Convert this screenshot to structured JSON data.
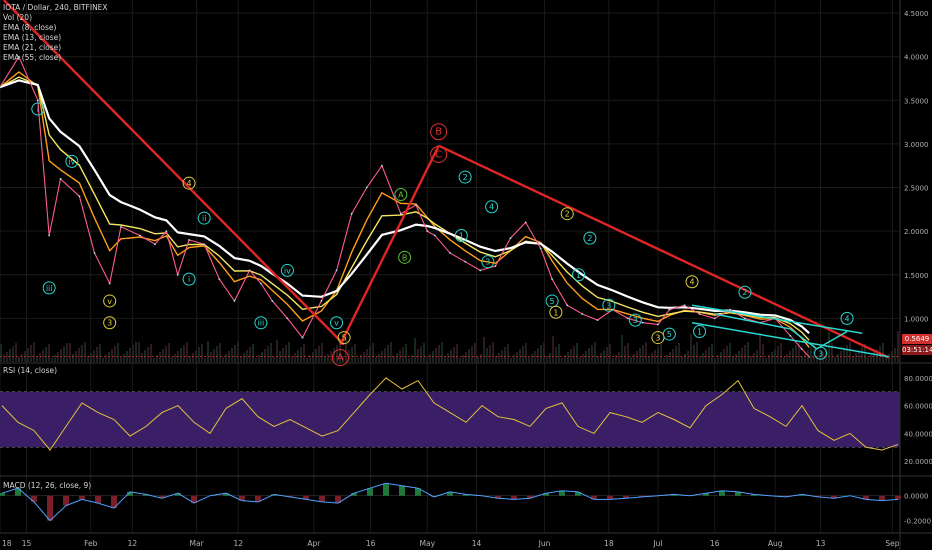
{
  "header": {
    "symbol_line": "IOTA / Dollar, 240, BITFINEX",
    "indicators": [
      "Vol (20)",
      "EMA (8, close)",
      "EMA (13, close)",
      "EMA (21, close)",
      "EMA (55, close)"
    ]
  },
  "price_tags": {
    "last_price": "0.5649",
    "countdown": "03:51:14"
  },
  "rsi_label": "RSI (14, close)",
  "macd_label": "MACD (12, 26, close, 9)",
  "chart_data": [
    {
      "type": "line",
      "title": "IOTA / Dollar, 240, BITFINEX",
      "x_tick_labels": [
        "18",
        "15",
        "Feb",
        "12",
        "Mar",
        "12",
        "Apr",
        "16",
        "May",
        "14",
        "Jun",
        "18",
        "Jul",
        "16",
        "Aug",
        "13",
        "Sep"
      ],
      "y_tick_labels": [
        "4.5000",
        "4.0000",
        "3.5000",
        "3.0000",
        "2.5000",
        "2.0000",
        "1.5000",
        "1.0000"
      ],
      "ylim": [
        0.5,
        4.65
      ],
      "grid": true,
      "series": [
        {
          "name": "IOTA / Dollar",
          "color": "#ff5b8d",
          "x": [
            "2018-01-08",
            "2018-01-13",
            "2018-01-18",
            "2018-01-21",
            "2018-01-24",
            "2018-01-29",
            "2018-02-02",
            "2018-02-06",
            "2018-02-09",
            "2018-02-14",
            "2018-02-18",
            "2018-02-21",
            "2018-02-24",
            "2018-02-27",
            "2018-03-03",
            "2018-03-07",
            "2018-03-11",
            "2018-03-15",
            "2018-03-18",
            "2018-03-21",
            "2018-03-25",
            "2018-03-29",
            "2018-04-03",
            "2018-04-07",
            "2018-04-11",
            "2018-04-15",
            "2018-04-19",
            "2018-04-24",
            "2018-04-28",
            "2018-05-01",
            "2018-05-03",
            "2018-05-07",
            "2018-05-11",
            "2018-05-15",
            "2018-05-19",
            "2018-05-23",
            "2018-05-27",
            "2018-05-31",
            "2018-06-03",
            "2018-06-07",
            "2018-06-11",
            "2018-06-15",
            "2018-06-19",
            "2018-06-23",
            "2018-06-27",
            "2018-07-01",
            "2018-07-04",
            "2018-07-08",
            "2018-07-12",
            "2018-07-16",
            "2018-07-20",
            "2018-07-24",
            "2018-07-28",
            "2018-08-01",
            "2018-08-05",
            "2018-08-08",
            "2018-08-10"
          ],
          "y": [
            3.65,
            4.0,
            3.5,
            1.95,
            2.6,
            2.4,
            1.75,
            1.4,
            2.05,
            1.95,
            1.85,
            2.0,
            1.5,
            1.9,
            1.85,
            1.45,
            1.2,
            1.55,
            1.4,
            1.2,
            1.0,
            0.78,
            1.2,
            1.55,
            2.2,
            2.5,
            2.75,
            2.2,
            2.3,
            2.0,
            1.95,
            1.75,
            1.65,
            1.55,
            1.6,
            1.92,
            2.1,
            1.8,
            1.45,
            1.15,
            1.05,
            0.98,
            1.1,
            1.0,
            0.95,
            0.93,
            1.1,
            1.15,
            1.05,
            1.0,
            1.1,
            1.0,
            0.95,
            1.0,
            0.8,
            0.65,
            0.56
          ]
        }
      ]
    },
    {
      "type": "line",
      "title": "RSI (14, close)",
      "y_tick_labels": [
        "80.0000",
        "60.0000",
        "40.0000",
        "20.0000"
      ],
      "ylim": [
        10,
        90
      ],
      "band": [
        30,
        70
      ],
      "series": [
        {
          "name": "RSI (14, close)",
          "color": "#e1c43b",
          "y": [
            60,
            48,
            42,
            28,
            45,
            62,
            55,
            50,
            38,
            45,
            55,
            60,
            48,
            40,
            58,
            65,
            52,
            45,
            50,
            44,
            38,
            42,
            55,
            68,
            80,
            72,
            78,
            62,
            55,
            48,
            60,
            52,
            50,
            45,
            58,
            62,
            45,
            40,
            55,
            52,
            48,
            55,
            50,
            44,
            60,
            68,
            78,
            58,
            52,
            45,
            60,
            42,
            35,
            40,
            30,
            28,
            32
          ]
        }
      ]
    },
    {
      "type": "line",
      "title": "MACD (12, 26, close, 9)",
      "y_tick_labels": [
        "0.0000",
        "-0.2000"
      ],
      "ylim": [
        -0.3,
        0.15
      ],
      "series": [
        {
          "name": "MACD (12, 26, close, 9)",
          "color": "#4ea1ff",
          "y": [
            0.02,
            0.06,
            -0.05,
            -0.2,
            -0.08,
            -0.03,
            -0.06,
            -0.1,
            0.03,
            0.01,
            -0.02,
            0.02,
            -0.06,
            0.0,
            0.02,
            -0.04,
            -0.05,
            0.01,
            -0.01,
            -0.03,
            -0.05,
            -0.06,
            0.02,
            0.06,
            0.1,
            0.08,
            0.06,
            -0.01,
            0.03,
            0.01,
            0.0,
            -0.02,
            -0.03,
            -0.02,
            0.02,
            0.04,
            0.03,
            -0.03,
            -0.03,
            -0.02,
            -0.01,
            0.0,
            0.01,
            0.0,
            0.02,
            0.04,
            0.03,
            0.01,
            0.0,
            -0.01,
            0.01,
            -0.01,
            -0.02,
            0.0,
            -0.03,
            -0.04,
            -0.03
          ]
        }
      ]
    }
  ],
  "wave_labels": [
    {
      "text": "i",
      "color": "#2bd6cf",
      "x": "2018-01-18",
      "y": 3.4
    },
    {
      "text": "iii",
      "color": "#2bd6cf",
      "x": "2018-01-21",
      "y": 1.35
    },
    {
      "text": "iv",
      "color": "#2bd6cf",
      "x": "2018-01-27",
      "y": 2.8
    },
    {
      "text": "v",
      "color": "#e0d040",
      "x": "2018-02-06",
      "y": 1.2
    },
    {
      "text": "3",
      "color": "#e0d040",
      "x": "2018-02-06",
      "y": 0.95
    },
    {
      "text": "4",
      "color": "#e0d040",
      "x": "2018-02-27",
      "y": 2.55
    },
    {
      "text": "ii",
      "color": "#2bd6cf",
      "x": "2018-03-03",
      "y": 2.15
    },
    {
      "text": "i",
      "color": "#2bd6cf",
      "x": "2018-02-27",
      "y": 1.45
    },
    {
      "text": "iii",
      "color": "#2bd6cf",
      "x": "2018-03-18",
      "y": 0.95
    },
    {
      "text": "iv",
      "color": "#2bd6cf",
      "x": "2018-03-25",
      "y": 1.55
    },
    {
      "text": "v",
      "color": "#2bd6cf",
      "x": "2018-04-07",
      "y": 0.95
    },
    {
      "text": "5",
      "color": "#e0d040",
      "x": "2018-04-09",
      "y": 0.78
    },
    {
      "text": "A",
      "color": "#e03030",
      "x": "2018-04-08",
      "y": 0.55
    },
    {
      "text": "A",
      "color": "#5bc236",
      "x": "2018-04-24",
      "y": 2.42
    },
    {
      "text": "B",
      "color": "#5bc236",
      "x": "2018-04-25",
      "y": 1.7
    },
    {
      "text": "C",
      "color": "#e03030",
      "x": "2018-05-04",
      "y": 2.88
    },
    {
      "text": "B",
      "color": "#e03030",
      "x": "2018-05-04",
      "y": 3.14
    },
    {
      "text": "2",
      "color": "#2bd6cf",
      "x": "2018-05-11",
      "y": 2.62
    },
    {
      "text": "1",
      "color": "#2bd6cf",
      "x": "2018-05-10",
      "y": 1.95
    },
    {
      "text": "4",
      "color": "#2bd6cf",
      "x": "2018-05-18",
      "y": 2.28
    },
    {
      "text": "3",
      "color": "#2bd6cf",
      "x": "2018-05-17",
      "y": 1.65
    },
    {
      "text": "2",
      "color": "#e0d040",
      "x": "2018-06-07",
      "y": 2.2
    },
    {
      "text": "2",
      "color": "#2bd6cf",
      "x": "2018-06-13",
      "y": 1.92
    },
    {
      "text": "1",
      "color": "#2bd6cf",
      "x": "2018-06-10",
      "y": 1.5
    },
    {
      "text": "5",
      "color": "#2bd6cf",
      "x": "2018-06-03",
      "y": 1.2
    },
    {
      "text": "1",
      "color": "#e0d040",
      "x": "2018-06-04",
      "y": 1.07
    },
    {
      "text": "3",
      "color": "#2bd6cf",
      "x": "2018-06-18",
      "y": 1.15
    },
    {
      "text": "3",
      "color": "#2bd6cf",
      "x": "2018-06-25",
      "y": 0.98
    },
    {
      "text": "3",
      "color": "#e0d040",
      "x": "2018-07-01",
      "y": 0.78
    },
    {
      "text": "5",
      "color": "#2bd6cf",
      "x": "2018-07-04",
      "y": 0.82
    },
    {
      "text": "4",
      "color": "#e0d040",
      "x": "2018-07-10",
      "y": 1.42
    },
    {
      "text": "1",
      "color": "#2bd6cf",
      "x": "2018-07-12",
      "y": 0.85
    },
    {
      "text": "2",
      "color": "#2bd6cf",
      "x": "2018-07-24",
      "y": 1.3
    },
    {
      "text": "3",
      "color": "#2bd6cf",
      "x": "2018-08-13",
      "y": 0.6
    },
    {
      "text": "4",
      "color": "#2bd6cf",
      "x": "2018-08-20",
      "y": 1.0
    }
  ],
  "trend_lines": [
    {
      "color": "#e02525",
      "points": [
        [
          "2018-01-09",
          4.65
        ],
        [
          "2018-04-09",
          0.7
        ]
      ]
    },
    {
      "color": "#e02525",
      "points": [
        [
          "2018-04-08",
          0.7
        ],
        [
          "2018-05-04",
          2.98
        ]
      ]
    },
    {
      "color": "#e02525",
      "points": [
        [
          "2018-05-04",
          2.98
        ],
        [
          "2018-08-31",
          0.55
        ]
      ]
    },
    {
      "color": "#2bd6cf",
      "points": [
        [
          "2018-07-10",
          1.15
        ],
        [
          "2018-08-24",
          0.83
        ]
      ]
    },
    {
      "color": "#2bd6cf",
      "points": [
        [
          "2018-07-10",
          0.95
        ],
        [
          "2018-08-31",
          0.56
        ]
      ]
    },
    {
      "color": "#2bd6cf",
      "points": [
        [
          "2018-07-16",
          1.05
        ],
        [
          "2018-08-05",
          0.88
        ],
        [
          "2018-08-12",
          0.65
        ],
        [
          "2018-08-20",
          0.85
        ]
      ]
    }
  ],
  "colors": {
    "background": "#000000",
    "grid": "#1a1a1a",
    "axis_text": "#b0b0b0",
    "rsi_band": "#3a1e66",
    "last_price_tag": "#d32f2f",
    "countdown_tag": "#8b1a1a",
    "ema8": "#ff9f1a",
    "ema13": "#f5e663",
    "ema21": "#ffffff"
  }
}
